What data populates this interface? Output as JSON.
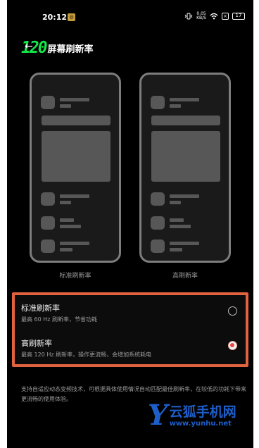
{
  "status_bar": {
    "time": "20:12",
    "notification_icon": "app-notification-icon",
    "net_speed_value": "0.05",
    "net_speed_unit": "KB/S",
    "sim_indicator": "×",
    "battery": "17"
  },
  "header": {
    "logo_text": "120",
    "title": "屏幕刷新率"
  },
  "previews": {
    "standard_label": "标准刷新率",
    "high_label": "高刷新率"
  },
  "options": [
    {
      "title": "标准刷新率",
      "desc": "最高 60 Hz 刷新率，节省功耗",
      "selected": false
    },
    {
      "title": "高刷新率",
      "desc": "最高 120 Hz 刷新率，操作更流畅，会增加系统耗电",
      "selected": true
    }
  ],
  "footnote": "支持自适应动态变频技术，可根据具体使用情况自动匹配最佳刷新率，在较低的功耗下带来更流畅的使用体验。",
  "watermark": {
    "letter": "Y",
    "name": "云狐手机网",
    "url": "www.yunhu.net"
  },
  "colors": {
    "accent_green": "#14e64a",
    "highlight_border": "#e0623f",
    "radio_selected": "#e54b4b",
    "watermark_blue": "#1e5ec9"
  }
}
